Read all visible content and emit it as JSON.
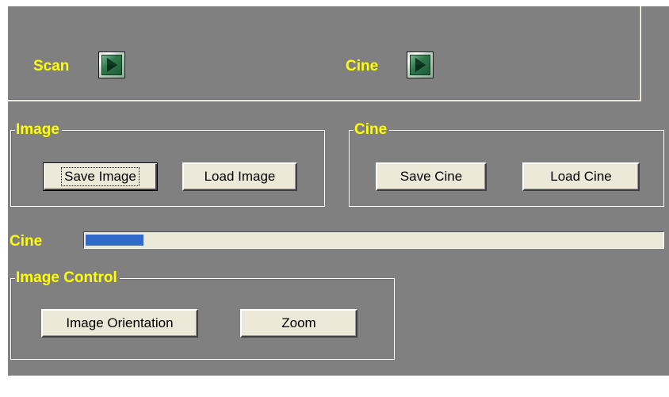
{
  "top": {
    "scan_label": "Scan",
    "cine_label": "Cine",
    "scan_play_icon": "play-icon",
    "cine_play_icon": "play-icon"
  },
  "image_group": {
    "title": "Image",
    "save_label": "Save Image",
    "load_label": "Load Image"
  },
  "cine_group": {
    "title": "Cine",
    "save_label": "Save Cine",
    "load_label": "Load Cine"
  },
  "cine_progress": {
    "label": "Cine",
    "fraction": 0.1
  },
  "image_control_group": {
    "title": "Image Control",
    "orientation_label": "Image Orientation",
    "zoom_label": "Zoom"
  },
  "colors": {
    "background": "#808080",
    "label_text": "#ffff00",
    "button_face": "#ece9d8",
    "progress_fill": "#3269c9"
  }
}
